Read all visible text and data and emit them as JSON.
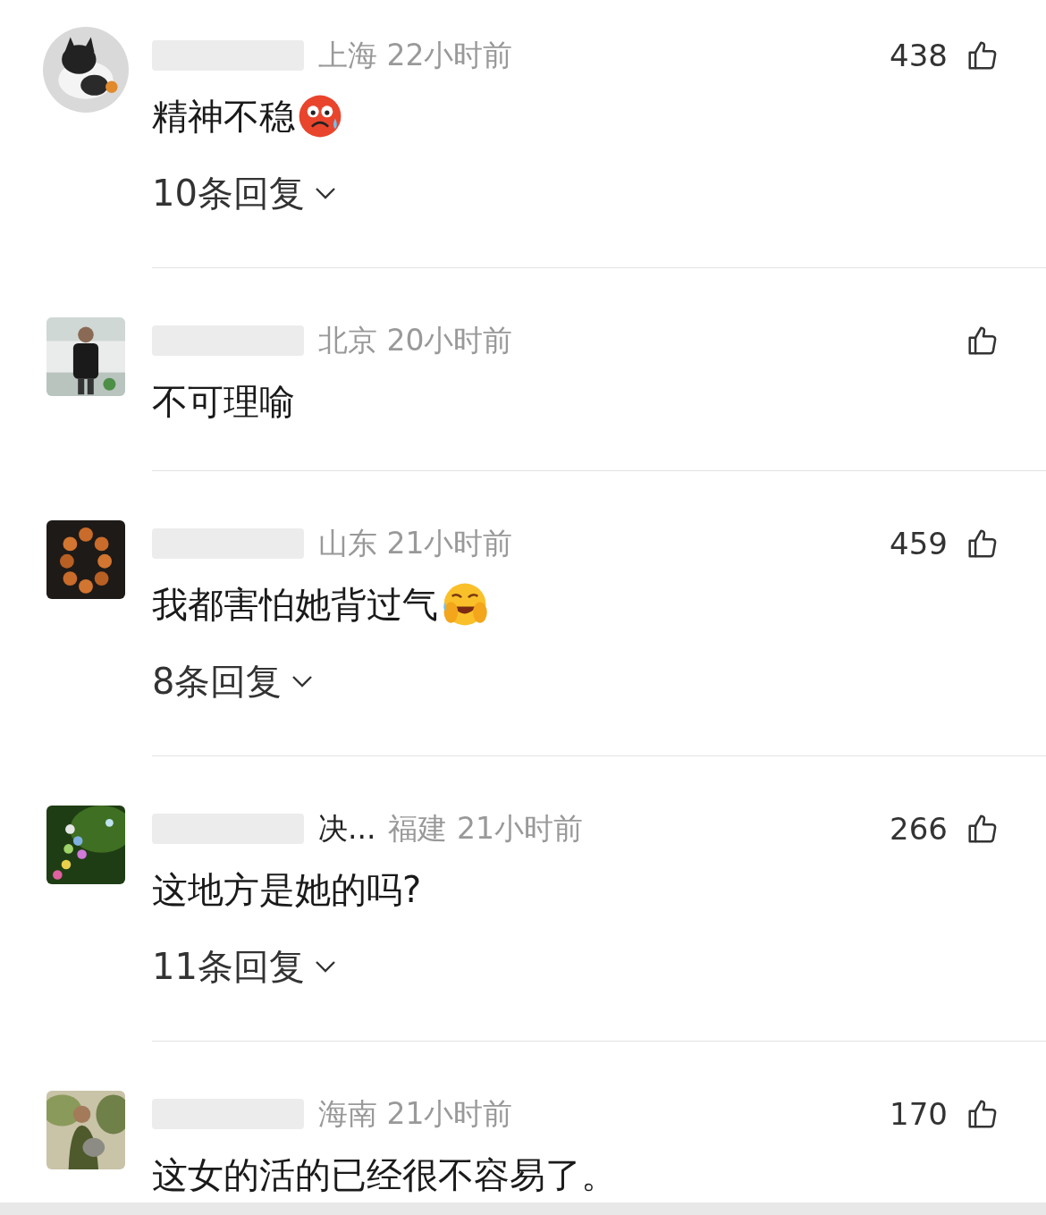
{
  "comments": [
    {
      "avatar": {
        "kind": "round"
      },
      "meta": "上海 22小时前",
      "likes": "438",
      "text": "精神不稳",
      "emoji": {
        "kind": "angry"
      },
      "replies": "10条回复"
    },
    {
      "avatar": {
        "kind": "square"
      },
      "meta": "北京 20小时前",
      "text": "不可理喻"
    },
    {
      "avatar": {
        "kind": "square"
      },
      "meta": "山东 21小时前",
      "likes": "459",
      "text": "我都害怕她背过气",
      "emoji": {
        "kind": "laughing"
      },
      "replies": "8条回复"
    },
    {
      "avatar": {
        "kind": "square"
      },
      "name_tail": "决...",
      "meta": "福建 21小时前",
      "likes": "266",
      "text": "这地方是她的吗?",
      "replies": "11条回复"
    },
    {
      "avatar": {
        "kind": "square"
      },
      "meta": "海南 21小时前",
      "likes": "170",
      "text": "这女的活的已经很不容易了。"
    }
  ]
}
